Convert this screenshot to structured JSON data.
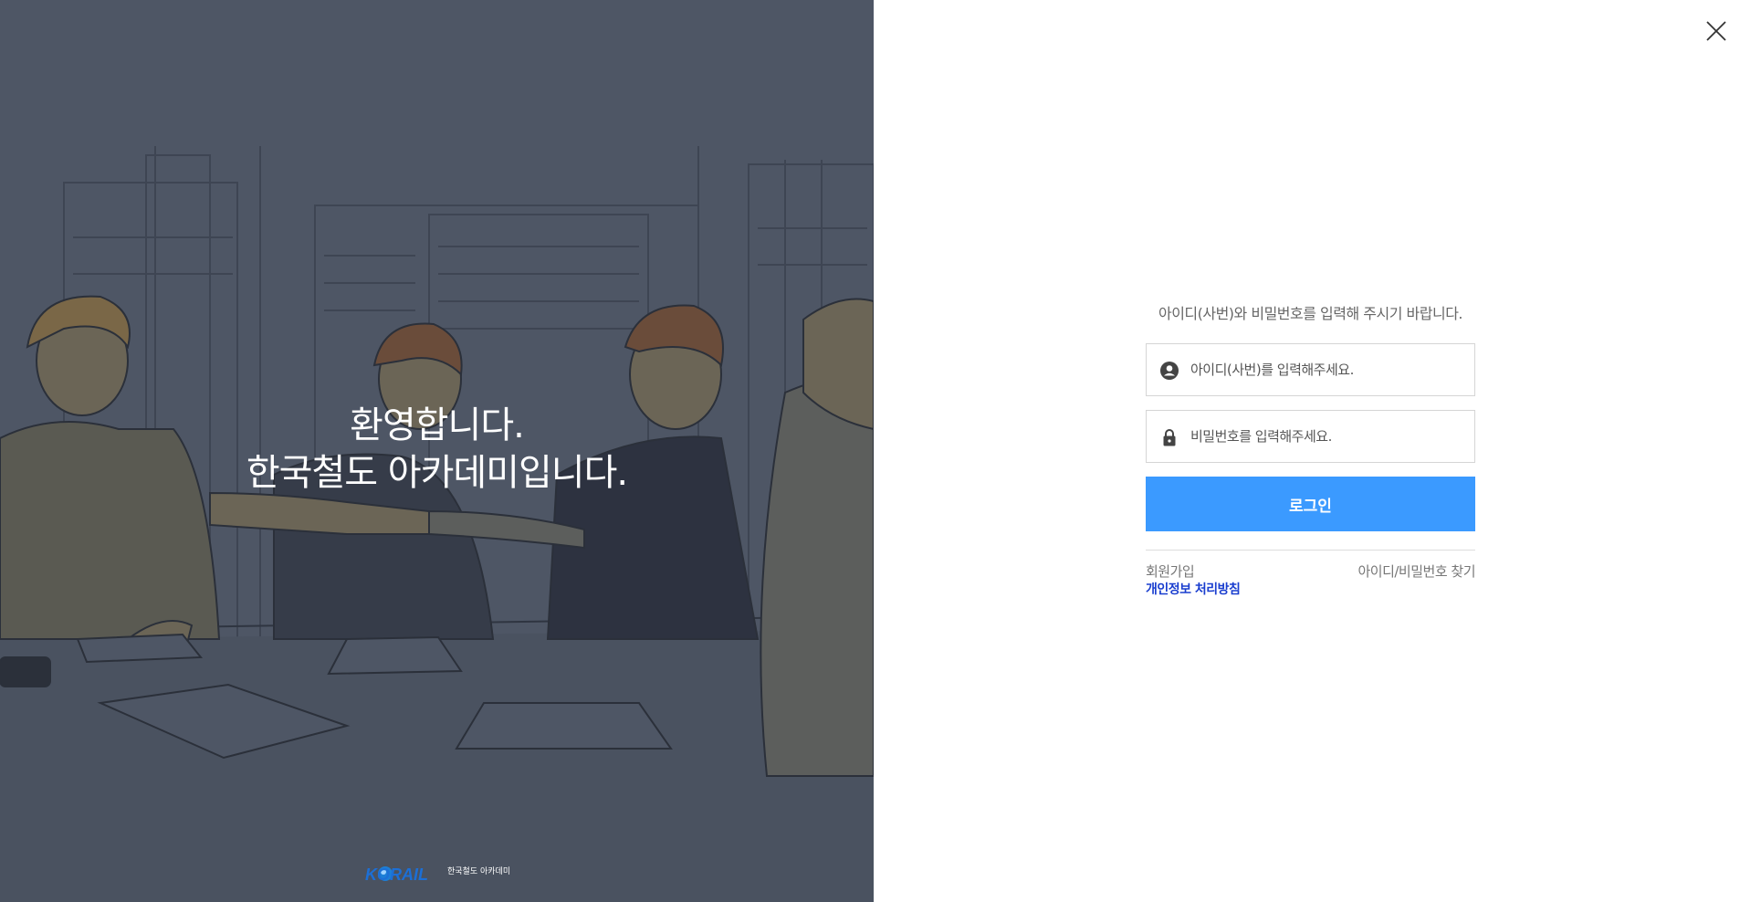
{
  "welcome": {
    "line1": "환영합니다.",
    "line2": "한국철도 아카데미입니다."
  },
  "logo": {
    "brand": "KORAIL",
    "sub": "한국철도 아카데미"
  },
  "login": {
    "instruction": "아이디(사번)와 비밀번호를 입력해 주시기 바랍니다.",
    "id_placeholder": "아이디(사번)를 입력해주세요.",
    "id_value": "",
    "pw_placeholder": "비밀번호를 입력해주세요.",
    "pw_value": "",
    "button": "로그인",
    "join": "회원가입",
    "privacy": "개인정보 처리방침",
    "find": "아이디/비밀번호 찾기"
  },
  "colors": {
    "left_bg": "#4e5665",
    "accent": "#3b9aff",
    "privacy_link": "#1a3ecf"
  },
  "icons": {
    "close": "close-icon",
    "user": "user-icon",
    "lock": "lock-icon"
  }
}
